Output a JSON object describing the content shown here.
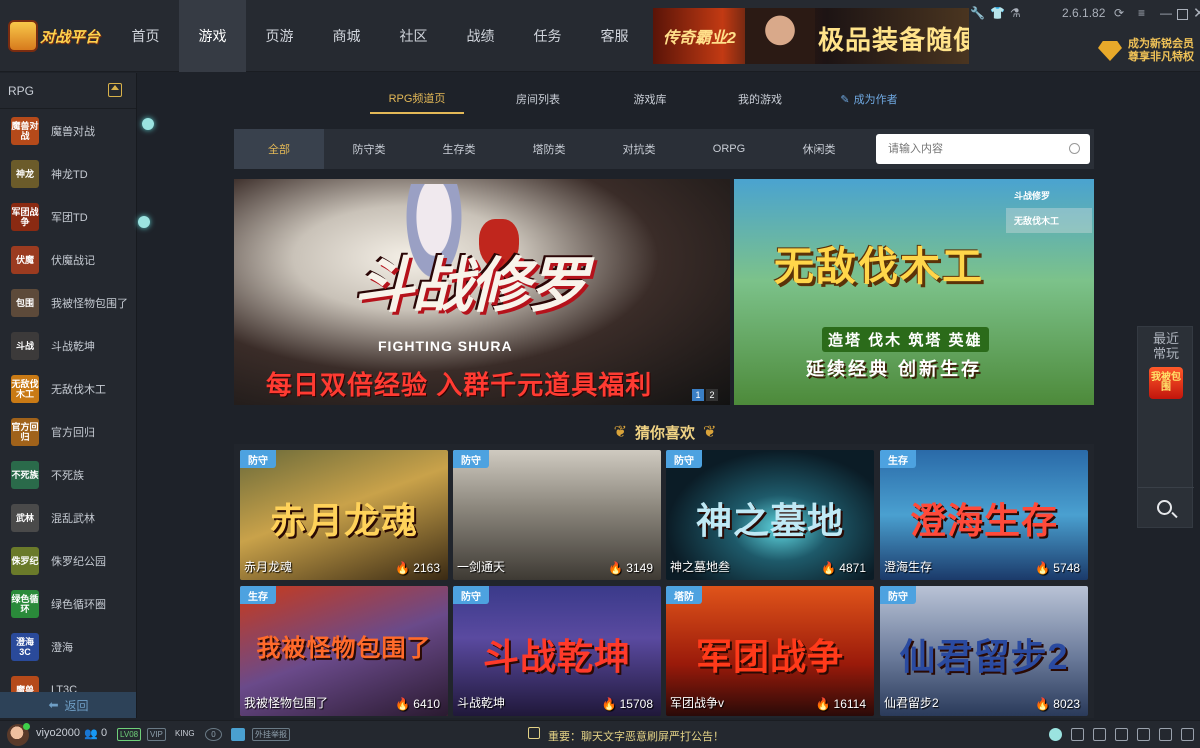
{
  "app": {
    "logo_text": "对战平台"
  },
  "nav": [
    {
      "label": "首页"
    },
    {
      "label": "游戏"
    },
    {
      "label": "页游"
    },
    {
      "label": "商城"
    },
    {
      "label": "社区"
    },
    {
      "label": "战绩"
    },
    {
      "label": "任务"
    },
    {
      "label": "客服"
    }
  ],
  "top_ad": {
    "left_text": "传奇霸业2",
    "text": "极品装备随便"
  },
  "version": "2.6.1.82",
  "vip_promo": {
    "line1": "成为新锐会员",
    "line2": "尊享非凡特权"
  },
  "sidebar": {
    "header": "RPG",
    "back_label": "返回",
    "items": [
      {
        "label": "魔兽对战",
        "icon_text": "魔兽对战",
        "color": "#b54a1a"
      },
      {
        "label": "神龙TD",
        "icon_text": "神龙",
        "color": "#6b5b2a"
      },
      {
        "label": "军团TD",
        "icon_text": "军团战争",
        "color": "#8a2a12"
      },
      {
        "label": "伏魔战记",
        "icon_text": "伏魔",
        "color": "#9b3b20"
      },
      {
        "label": "我被怪物包围了",
        "icon_text": "包围",
        "color": "#5d4a3a"
      },
      {
        "label": "斗战乾坤",
        "icon_text": "斗战",
        "color": "#3c3a3a"
      },
      {
        "label": "无敌伐木工",
        "icon_text": "无敌伐木工",
        "color": "#c97a15"
      },
      {
        "label": "官方回归",
        "icon_text": "官方回归",
        "color": "#a0621a"
      },
      {
        "label": "不死族",
        "icon_text": "不死族",
        "color": "#2a6a4a"
      },
      {
        "label": "混乱武林",
        "icon_text": "武林",
        "color": "#4a4a4a"
      },
      {
        "label": "侏罗纪公园",
        "icon_text": "侏罗纪",
        "color": "#6a7a2a"
      },
      {
        "label": "绿色循环圈",
        "icon_text": "绿色循环",
        "color": "#2a8a3a"
      },
      {
        "label": "澄海",
        "icon_text": "澄海3C",
        "color": "#2a4a9a"
      },
      {
        "label": "LT3C",
        "icon_text": "魔兽",
        "color": "#b54a1a"
      }
    ]
  },
  "subtabs": [
    {
      "label": "RPG频道页"
    },
    {
      "label": "房间列表"
    },
    {
      "label": "游戏库"
    },
    {
      "label": "我的游戏"
    },
    {
      "label": "成为作者"
    }
  ],
  "categories": [
    {
      "label": "全部"
    },
    {
      "label": "防守类"
    },
    {
      "label": "生存类"
    },
    {
      "label": "塔防类"
    },
    {
      "label": "对抗类"
    },
    {
      "label": "ORPG"
    },
    {
      "label": "休闲类"
    }
  ],
  "search": {
    "placeholder": "请输入内容"
  },
  "banner_main": {
    "title": "斗战修罗",
    "subtitle": "FIGHTING SHURA",
    "slogan": "每日双倍经验 入群千元道具福利",
    "pages": [
      "1",
      "2"
    ]
  },
  "banner_side": {
    "title": "无敌伐木工",
    "line1": "造塔 伐木 筑塔 英雄",
    "line2": "延续经典 创新生存",
    "list": [
      "斗战修罗",
      "无敌伐木工"
    ]
  },
  "section_title": "猜你喜欢",
  "games": [
    {
      "tag": "防守",
      "title": "赤月龙魂",
      "hot": "2163",
      "art_text": "赤月龙魂",
      "bg": "linear-gradient(160deg,#6a6a3a,#c9a24a 45%,#3a2a14)",
      "art_color": "#ffd25a"
    },
    {
      "tag": "防守",
      "title": "一剑通天",
      "hot": "3149",
      "art_text": "",
      "bg": "linear-gradient(180deg,#cfcac0,#8b867c 45%,#3e3a34)",
      "art_color": "#fff"
    },
    {
      "tag": "防守",
      "title": "神之墓地叁",
      "hot": "4871",
      "art_text": "神之墓地",
      "bg": "radial-gradient(ellipse at 55% 60%,#5fd6e0 0,#1e5a6a 30%,#0b1c26 70%)",
      "art_color": "#bfe9f5"
    },
    {
      "tag": "生存",
      "title": "澄海生存",
      "hot": "5748",
      "art_text": "澄海生存",
      "bg": "linear-gradient(180deg,#2a6aa8,#4aa0d0 50%,#1b3a6a)",
      "art_color": "#ff4a3a"
    },
    {
      "tag": "生存",
      "title": "我被怪物包围了",
      "hot": "6410",
      "art_text": "我被怪物包围了",
      "bg": "linear-gradient(160deg,#c93a1a,#6a4a8a 50%,#2a1a30)",
      "art_color": "#ff6a2a"
    },
    {
      "tag": "防守",
      "title": "斗战乾坤",
      "hot": "15708",
      "art_text": "斗战乾坤",
      "bg": "linear-gradient(180deg,#3a3a8a,#5a4aa0 40%,#20183a)",
      "art_color": "#ff3a2a"
    },
    {
      "tag": "塔防",
      "title": "军团战争v",
      "hot": "16114",
      "art_text": "军团战争",
      "bg": "linear-gradient(180deg,#e0541a,#9a1a0a 60%,#2a0a08)",
      "art_color": "#ff3a1a"
    },
    {
      "tag": "防守",
      "title": "仙君留步2",
      "hot": "8023",
      "art_text": "仙君留步2",
      "bg": "linear-gradient(180deg,#b9c3d6,#6a7a9a 55%,#2a3a5a)",
      "art_color": "#2a4aa0"
    }
  ],
  "recent": {
    "label": "最近常玩",
    "game_text": "我被包围"
  },
  "bottom": {
    "username": "viyo2000",
    "friends": "0",
    "badges": [
      "LV08",
      "VIP",
      "KING",
      "外挂举报"
    ],
    "shield": "0",
    "announcement": "重要：聊天文字恶意刷屏严打公告！"
  }
}
